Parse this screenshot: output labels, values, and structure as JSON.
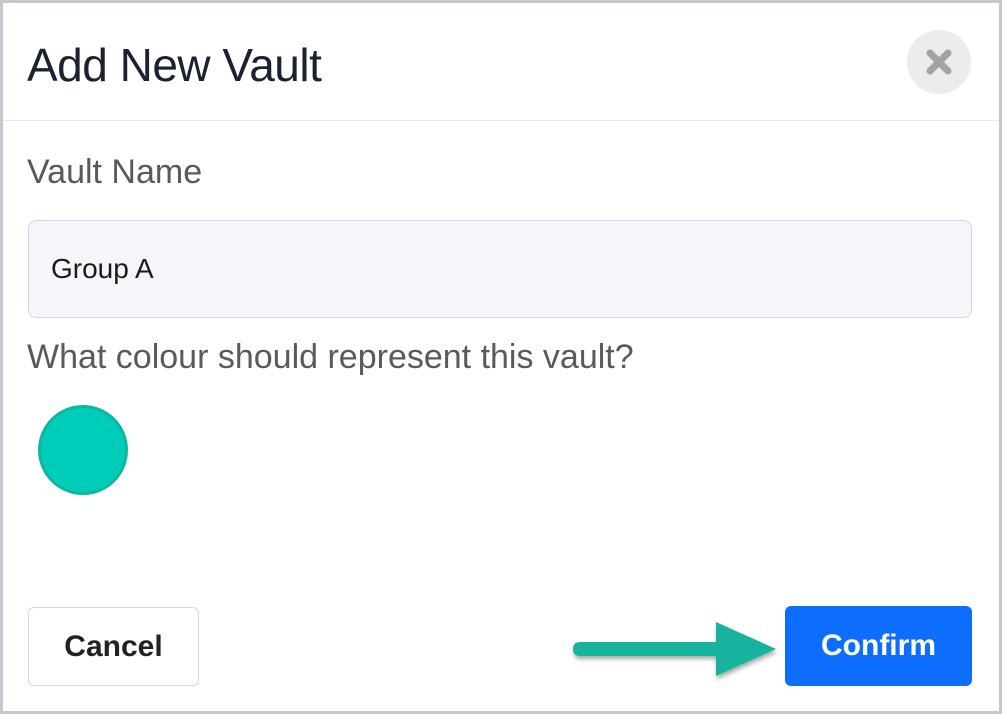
{
  "dialog": {
    "title": "Add New Vault",
    "close_icon": "close-x-icon"
  },
  "form": {
    "vault_name_label": "Vault Name",
    "vault_name_value": "Group A",
    "colour_label": "What colour should represent this vault?",
    "selected_colour": "#00cdb9"
  },
  "footer": {
    "cancel_label": "Cancel",
    "confirm_label": "Confirm",
    "annotation_arrow_icon": "pointer-arrow-icon",
    "annotation_arrow_color": "#15b39f"
  },
  "colors": {
    "primary": "#0d6efd",
    "swatch_border": "#0ab8a2"
  }
}
